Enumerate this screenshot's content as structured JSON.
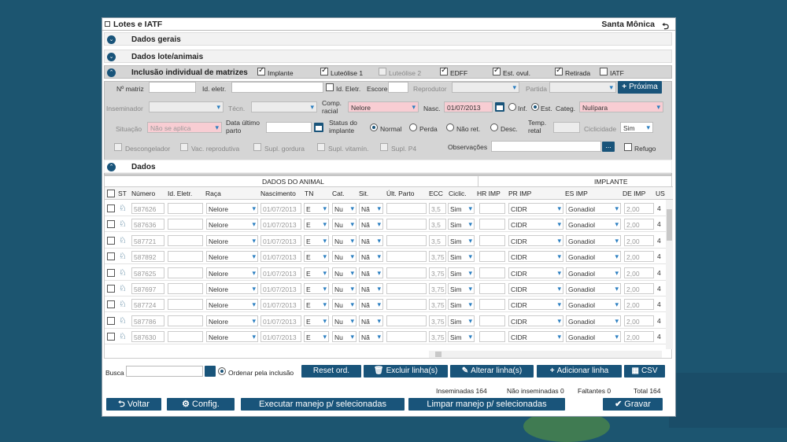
{
  "window": {
    "title": "Lotes e IATF",
    "farm": "Santa Mônica"
  },
  "sections": {
    "general": "Dados gerais",
    "lot": "Dados lote/animais",
    "individual": "Inclusão individual de matrizes",
    "data": "Dados"
  },
  "top_checks": {
    "implante": "Implante",
    "lute1": "Luteólise 1",
    "lute2": "Luteólise 2",
    "edff": "EDFF",
    "estovul": "Est. ovul.",
    "retirada": "Retirada",
    "iatf": "IATF"
  },
  "form": {
    "matriz_label": "Nº matriz",
    "ideletr_label": "Id. eletr.",
    "ideletr2_label": "Id. Eletr.",
    "escore_label": "Escore",
    "reprodutor_label": "Reprodutor",
    "partida_label": "Partida",
    "proxima": "Próxima",
    "inseminador_label": "Inseminador",
    "tecn_label": "Técn.",
    "comp_label": "Comp. racial",
    "comp_value": "Nelore",
    "nasc_label": "Nasc.",
    "nasc_value": "01/07/2013",
    "inf": "Inf.",
    "est": "Est.",
    "categ_label": "Categ.",
    "categ_value": "Nulípara",
    "situacao_label": "Situação",
    "situacao_value": "Não se aplica",
    "dataparto_label": "Data último parto",
    "status_label": "Status do implante",
    "normal": "Normal",
    "perda": "Perda",
    "naoret": "Não ret.",
    "desc": "Desc.",
    "temp_label": "Temp. retal",
    "ciclicidade_label": "Ciclicidade",
    "ciclicidade_value": "Sim",
    "descongelador": "Descongelador",
    "vac": "Vac. reprodutiva",
    "gordura": "Supl. gordura",
    "vitamin": "Supl. vitamín.",
    "p4": "Supl. P4",
    "obs_label": "Observações",
    "obs_btn": "...",
    "refugo": "Refugo"
  },
  "grid": {
    "group1": "DADOS DO ANIMAL",
    "group2": "IMPLANTE",
    "cols": [
      "ST",
      "Número",
      "Id. Eletr.",
      "Raça",
      "Nascimento",
      "TN",
      "Cat.",
      "Sit.",
      "Últ. Parto",
      "ECC",
      "Ciclic.",
      "HR IMP",
      "PR IMP",
      "ES IMP",
      "DE IMP",
      "US"
    ],
    "rows": [
      {
        "num": "587626",
        "raca": "Nelore",
        "nasc": "01/07/2013",
        "tn": "E",
        "cat": "Nu",
        "sit": "Nã",
        "ecc": "3,5",
        "cic": "Sim",
        "pr": "CIDR",
        "es": "Gonadiol",
        "de": "2,00",
        "us": "4"
      },
      {
        "num": "587636",
        "raca": "Nelore",
        "nasc": "01/07/2013",
        "tn": "E",
        "cat": "Nu",
        "sit": "Nã",
        "ecc": "3,5",
        "cic": "Sim",
        "pr": "CIDR",
        "es": "Gonadiol",
        "de": "2,00",
        "us": "4"
      },
      {
        "num": "587721",
        "raca": "Nelore",
        "nasc": "01/07/2013",
        "tn": "E",
        "cat": "Nu",
        "sit": "Nã",
        "ecc": "3,5",
        "cic": "Sim",
        "pr": "CIDR",
        "es": "Gonadiol",
        "de": "2,00",
        "us": "4"
      },
      {
        "num": "587892",
        "raca": "Nelore",
        "nasc": "01/07/2013",
        "tn": "E",
        "cat": "Nu",
        "sit": "Nã",
        "ecc": "3,75",
        "cic": "Sim",
        "pr": "CIDR",
        "es": "Gonadiol",
        "de": "2,00",
        "us": "4"
      },
      {
        "num": "587625",
        "raca": "Nelore",
        "nasc": "01/07/2013",
        "tn": "E",
        "cat": "Nu",
        "sit": "Nã",
        "ecc": "3,75",
        "cic": "Sim",
        "pr": "CIDR",
        "es": "Gonadiol",
        "de": "2,00",
        "us": "4"
      },
      {
        "num": "587697",
        "raca": "Nelore",
        "nasc": "01/07/2013",
        "tn": "E",
        "cat": "Nu",
        "sit": "Nã",
        "ecc": "3,75",
        "cic": "Sim",
        "pr": "CIDR",
        "es": "Gonadiol",
        "de": "2,00",
        "us": "4"
      },
      {
        "num": "587724",
        "raca": "Nelore",
        "nasc": "01/07/2013",
        "tn": "E",
        "cat": "Nu",
        "sit": "Nã",
        "ecc": "3,75",
        "cic": "Sim",
        "pr": "CIDR",
        "es": "Gonadiol",
        "de": "2,00",
        "us": "4"
      },
      {
        "num": "587786",
        "raca": "Nelore",
        "nasc": "01/07/2013",
        "tn": "E",
        "cat": "Nu",
        "sit": "Nã",
        "ecc": "3,75",
        "cic": "Sim",
        "pr": "CIDR",
        "es": "Gonadiol",
        "de": "2,00",
        "us": "4"
      },
      {
        "num": "587630",
        "raca": "Nelore",
        "nasc": "01/07/2013",
        "tn": "E",
        "cat": "Nu",
        "sit": "Nã",
        "ecc": "3,75",
        "cic": "Sim",
        "pr": "CIDR",
        "es": "Gonadiol",
        "de": "2,00",
        "us": "4"
      }
    ]
  },
  "search": {
    "label": "Busca",
    "order": "Ordenar pela inclusão"
  },
  "actions": {
    "reset": "Reset ord.",
    "excluir": "Excluir linha(s)",
    "alterar": "Alterar linha(s)",
    "adicionar": "Adicionar linha",
    "csv": "CSV"
  },
  "totals": {
    "insem": "Inseminadas 164",
    "naoinsem": "Não inseminadas 0",
    "faltantes": "Faltantes 0",
    "total": "Total 164"
  },
  "bottom": {
    "voltar": "Voltar",
    "config": "Config.",
    "executar": "Executar manejo p/ selecionadas",
    "limpar": "Limpar manejo p/ selecionadas",
    "gravar": "Gravar"
  }
}
